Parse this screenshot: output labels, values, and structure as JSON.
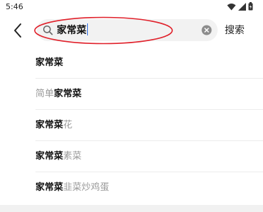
{
  "status_bar": {
    "time": "5:46",
    "icons": [
      "wifi-icon",
      "signal-icon",
      "battery-icon"
    ]
  },
  "search": {
    "back_icon": "chevron-left-icon",
    "search_icon": "magnifier-icon",
    "query": "家常菜",
    "clear_icon": "clear-icon",
    "submit_label": "搜索",
    "annotation_color": "#e0202a",
    "caret_color": "#2f6fe5"
  },
  "suggestions": [
    {
      "parts": [
        {
          "text": "家常菜",
          "match": true
        }
      ]
    },
    {
      "parts": [
        {
          "text": "简单",
          "match": false
        },
        {
          "text": "家常菜",
          "match": true
        }
      ]
    },
    {
      "parts": [
        {
          "text": "家常菜",
          "match": true
        },
        {
          "text": "花",
          "match": false
        }
      ]
    },
    {
      "parts": [
        {
          "text": "家常菜",
          "match": true
        },
        {
          "text": "素菜",
          "match": false
        }
      ]
    },
    {
      "parts": [
        {
          "text": "家常菜",
          "match": true
        },
        {
          "text": "韭菜炒鸡蛋",
          "match": false
        }
      ]
    }
  ]
}
